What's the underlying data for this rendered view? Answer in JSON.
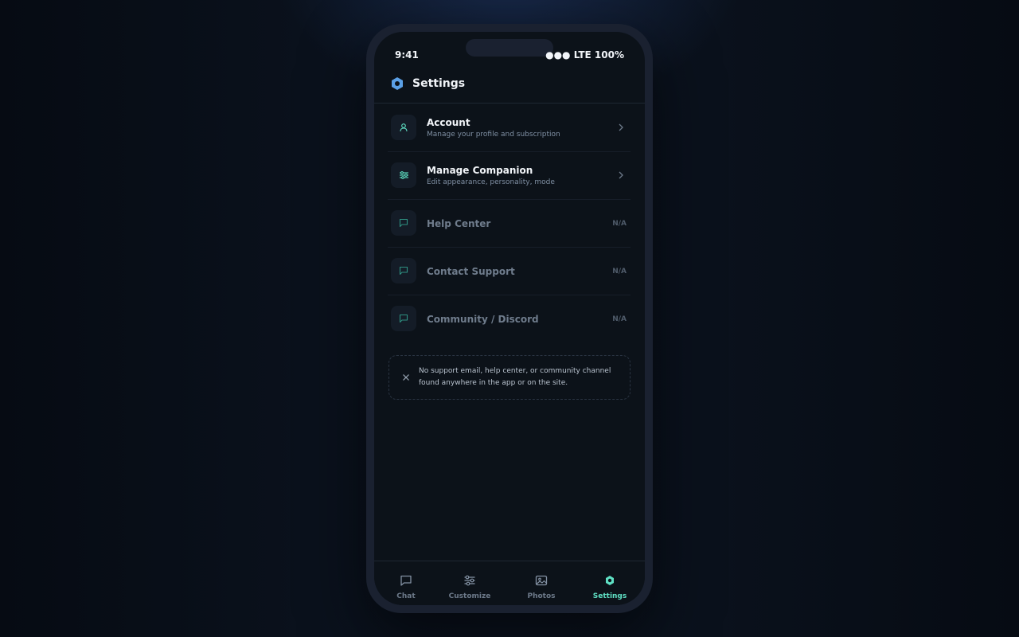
{
  "status_bar": {
    "time": "9:41",
    "signal": "●●● LTE 100%"
  },
  "header": {
    "title": "Settings",
    "logo_icon": "hexagon-logo-icon"
  },
  "settings": [
    {
      "title": "Account",
      "subtitle": "Manage your profile and subscription",
      "icon": "user-icon",
      "trailing": "chevron-right-icon",
      "enabled": true
    },
    {
      "title": "Manage Companion",
      "subtitle": "Edit appearance, personality, mode",
      "icon": "sliders-icon",
      "trailing": "chevron-right-icon",
      "enabled": true
    },
    {
      "title": "Help Center",
      "icon": "message-icon",
      "trailing_text": "N/A",
      "enabled": false
    },
    {
      "title": "Contact Support",
      "icon": "message-icon",
      "trailing_text": "N/A",
      "enabled": false
    },
    {
      "title": "Community / Discord",
      "icon": "message-icon",
      "trailing_text": "N/A",
      "enabled": false
    }
  ],
  "notice": {
    "icon": "close-icon",
    "text": "No support email, help center, or community channel found anywhere in the app or on the site."
  },
  "tabs": [
    {
      "label": "Chat",
      "icon": "chat-icon",
      "active": false
    },
    {
      "label": "Customize",
      "icon": "sliders-icon",
      "active": false
    },
    {
      "label": "Photos",
      "icon": "image-icon",
      "active": false
    },
    {
      "label": "Settings",
      "icon": "hexagon-settings-icon",
      "active": true
    }
  ],
  "colors": {
    "accent": "#5fe0c4",
    "background": "#0c1219",
    "frame": "#1a2130",
    "logo": "#5ba0e6"
  }
}
